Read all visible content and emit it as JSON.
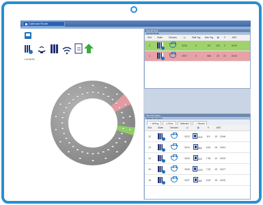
{
  "app": {
    "title": "Calendar Route"
  },
  "left": {
    "library_label": "Lst 08  Rs"
  },
  "colors": {
    "device_border": "#2a8fd0",
    "green_row": "#9fd36a",
    "red_row": "#e7a2a7",
    "slot_ring": "#9a9a9a",
    "slot_green": "#8bd060",
    "slot_red": "#e39aa0"
  },
  "special_slots": {
    "panel_title": "Special Slots",
    "sub_title": "Special Media",
    "columns": [
      "Slot",
      "State",
      "Devices",
      "",
      "Stall Tag",
      "Max Tag",
      "",
      "",
      "AMT"
    ],
    "rows": [
      {
        "slot": "0",
        "state_color": "green",
        "tag": "0006",
        "a": "0",
        "b": "107",
        "c": "100",
        "d": "0",
        "amt": "00:00"
      },
      {
        "slot": "1",
        "state_color": "red",
        "tag": "0007",
        "a": "0",
        "b": "888",
        "c": "20",
        "d": "21",
        "amt": "00:00"
      }
    ]
  },
  "media_info": {
    "panel_title": "Slot Information",
    "sub_title": "Media Information",
    "tabs": [
      "Writing",
      "Error",
      "Detected",
      "Moved"
    ],
    "columns": [
      "Slot",
      "State",
      "Devices",
      "",
      "",
      "",
      "AMT"
    ],
    "rows": [
      {
        "slot": "12",
        "id": "0012",
        "count": "1011",
        "val": "8.9",
        "n": "15",
        "amt": "15:46"
      },
      {
        "slot": "13",
        "id": "0014",
        "count": "882",
        "val": "8.44",
        "n": "15",
        "amt": "15:51"
      },
      {
        "slot": "14",
        "id": "0020",
        "count": "222",
        "val": "7.35",
        "n": "14",
        "amt": "15:23"
      },
      {
        "slot": "15",
        "id": "0026",
        "count": "1020",
        "val": "7.22",
        "n": "15",
        "amt": "15:27"
      },
      {
        "slot": "16",
        "id": "0027",
        "count": "182",
        "val": "6.15",
        "n": "15",
        "amt": "15:32"
      }
    ]
  }
}
